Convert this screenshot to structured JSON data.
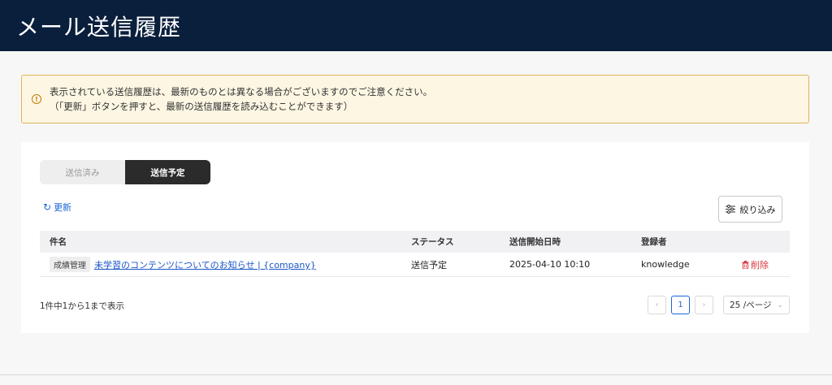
{
  "header": {
    "title": "メール送信履歴"
  },
  "alert": {
    "line1": "表示されている送信履歴は、最新のものとは異なる場合がございますのでご注意ください。",
    "line2": "（「更新」ボタンを押すと、最新の送信履歴を読み込むことができます）"
  },
  "tabs": [
    {
      "label": "送信済み",
      "active": false
    },
    {
      "label": "送信予定",
      "active": true
    }
  ],
  "toolbar": {
    "refresh_label": "更新",
    "filter_label": "絞り込み"
  },
  "table": {
    "headers": [
      "件名",
      "ステータス",
      "送信開始日時",
      "登録者"
    ],
    "rows": [
      {
        "tag": "成績管理",
        "subject": "未学習のコンテンツについてのお知らせ | {company}",
        "status": "送信予定",
        "start": "2025-04-10 10:10",
        "registrant": "knowledge",
        "delete_label": "削除"
      }
    ]
  },
  "pagination": {
    "summary": "1件中1から1まで表示",
    "current_page": "1",
    "page_size": "25 /ページ",
    "prev_icon": "‹",
    "next_icon": "›"
  },
  "colors": {
    "header_bg": "#0a1f3c",
    "alert_bg": "#fdf6e3",
    "alert_border": "#e0b45a",
    "link": "#1a55c8",
    "danger": "#d9363e",
    "active_tab": "#2b2b2b"
  }
}
